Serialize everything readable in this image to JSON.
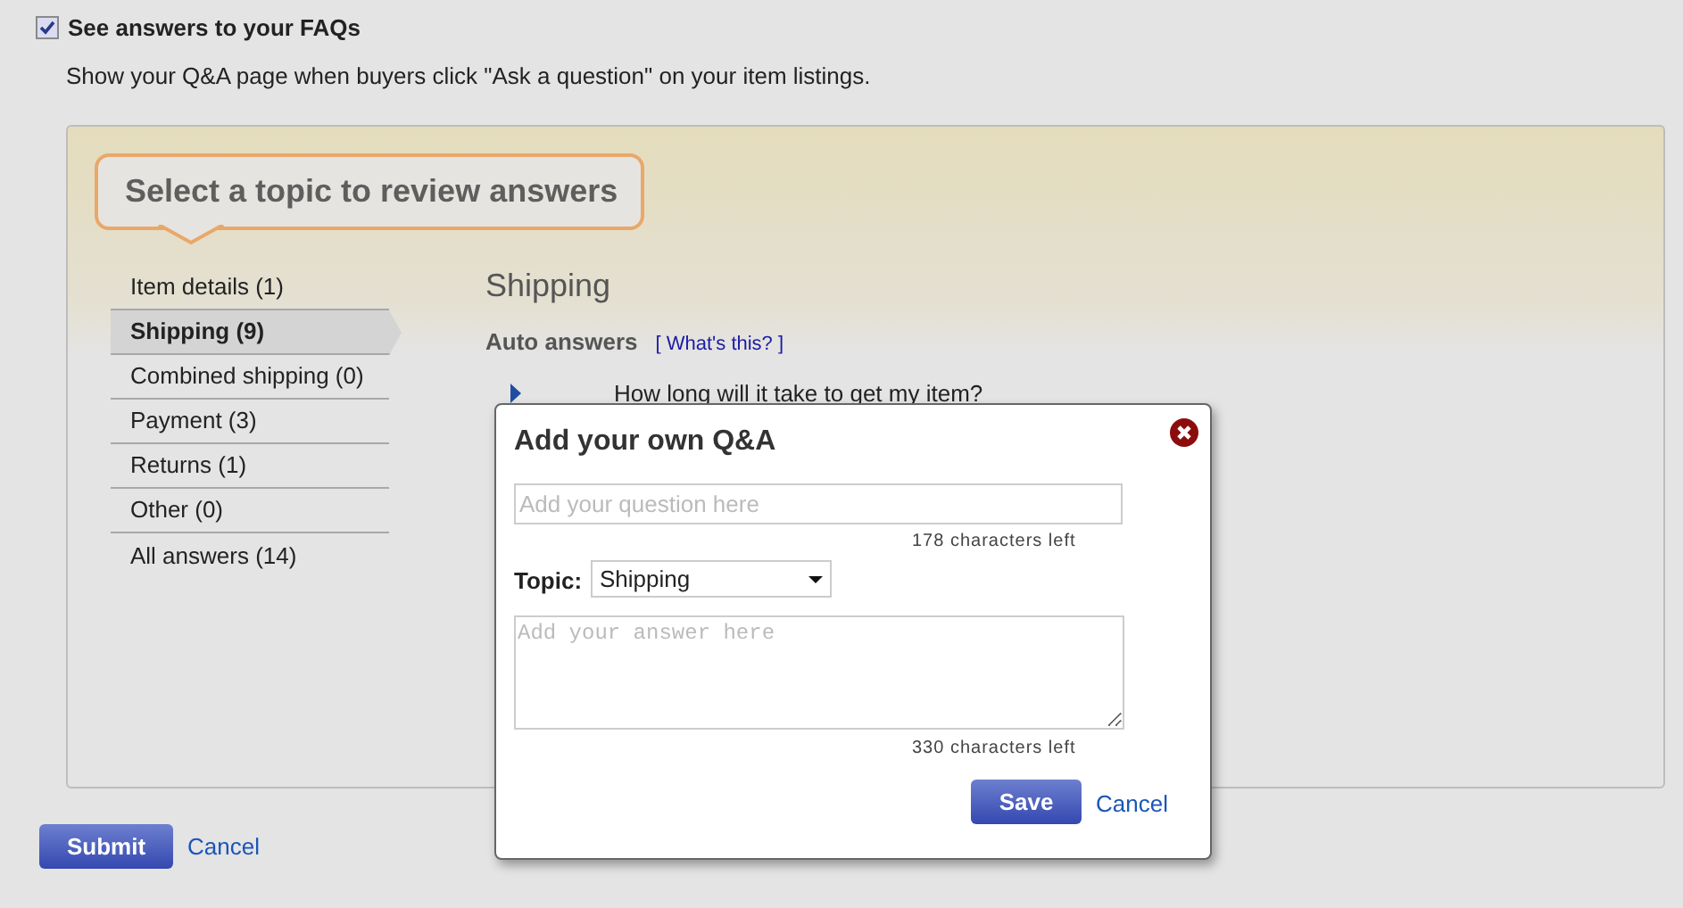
{
  "faq_option": {
    "label": "See answers to your FAQs",
    "checked": true,
    "description": "Show your Q&A page when buyers click \"Ask a question\" on your item listings."
  },
  "callout": "Select a topic to review answers",
  "topics": [
    {
      "label": "Item details (1)",
      "selected": false
    },
    {
      "label": "Shipping (9)",
      "selected": true
    },
    {
      "label": "Combined shipping (0)",
      "selected": false
    },
    {
      "label": "Payment (3)",
      "selected": false
    },
    {
      "label": "Returns (1)",
      "selected": false
    },
    {
      "label": "Other (0)",
      "selected": false
    },
    {
      "label": "All answers (14)",
      "selected": false
    }
  ],
  "content": {
    "heading": "Shipping",
    "section": "Auto answers",
    "help_link": "[ What's this? ]",
    "questions": [
      "How long will it take to get my item?"
    ]
  },
  "dialog": {
    "title": "Add your own Q&A",
    "question_placeholder": "Add your question here",
    "question_counter": "178 characters left",
    "topic_label": "Topic:",
    "topic_value": "Shipping",
    "answer_placeholder": "Add your answer here",
    "answer_counter": "330 characters left",
    "save": "Save",
    "cancel": "Cancel"
  },
  "buttons": {
    "submit": "Submit",
    "cancel": "Cancel"
  }
}
